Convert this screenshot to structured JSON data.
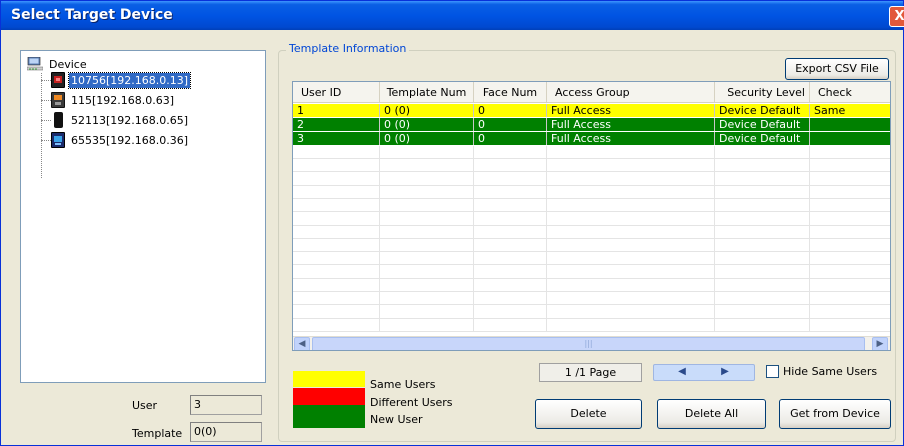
{
  "window": {
    "title": "Select Target Device",
    "close_glyph": "X"
  },
  "tree": {
    "root_label": "Device",
    "nodes": [
      {
        "label": "10756[192.168.0.13]",
        "icon": "device-red-icon",
        "selected": true
      },
      {
        "label": "115[192.168.0.63]",
        "icon": "device-orange-icon",
        "selected": false
      },
      {
        "label": "52113[192.168.0.65]",
        "icon": "device-black-icon",
        "selected": false
      },
      {
        "label": "65535[192.168.0.36]",
        "icon": "device-blue-icon",
        "selected": false
      }
    ]
  },
  "info": {
    "user_label": "User",
    "user_value": "3",
    "template_label": "Template",
    "template_value": "0(0)"
  },
  "template_info": {
    "group_title": "Template Information",
    "export_button": "Export CSV File",
    "columns": [
      "User ID",
      "Template Num",
      "Face Num",
      "Access Group",
      "Security Level",
      "Check"
    ],
    "rows": [
      {
        "user_id": "1",
        "template_num": "0 (0)",
        "face_num": "0",
        "access_group": "Full Access",
        "security_level": "Device Default",
        "check": "Same",
        "status": "same"
      },
      {
        "user_id": "2",
        "template_num": "0 (0)",
        "face_num": "0",
        "access_group": "Full Access",
        "security_level": "Device Default",
        "check": "",
        "status": "new"
      },
      {
        "user_id": "3",
        "template_num": "0 (0)",
        "face_num": "0",
        "access_group": "Full Access",
        "security_level": "Device Default",
        "check": "",
        "status": "new"
      }
    ]
  },
  "legend": [
    {
      "label": "Same Users",
      "color": "#ffff00"
    },
    {
      "label": "Different Users",
      "color": "#ff0000"
    },
    {
      "label": "New User",
      "color": "#008000"
    }
  ],
  "pager": {
    "page_text": "1 /1 Page",
    "prev_glyph": "◀",
    "next_glyph": "▶"
  },
  "hide_same": {
    "label": "Hide Same Users",
    "checked": false
  },
  "buttons": {
    "delete": "Delete",
    "delete_all": "Delete All",
    "get_from_device": "Get from Device"
  },
  "colors": {
    "same_row": "#ffff00",
    "new_row": "#008000",
    "selection": "#316ac5"
  }
}
